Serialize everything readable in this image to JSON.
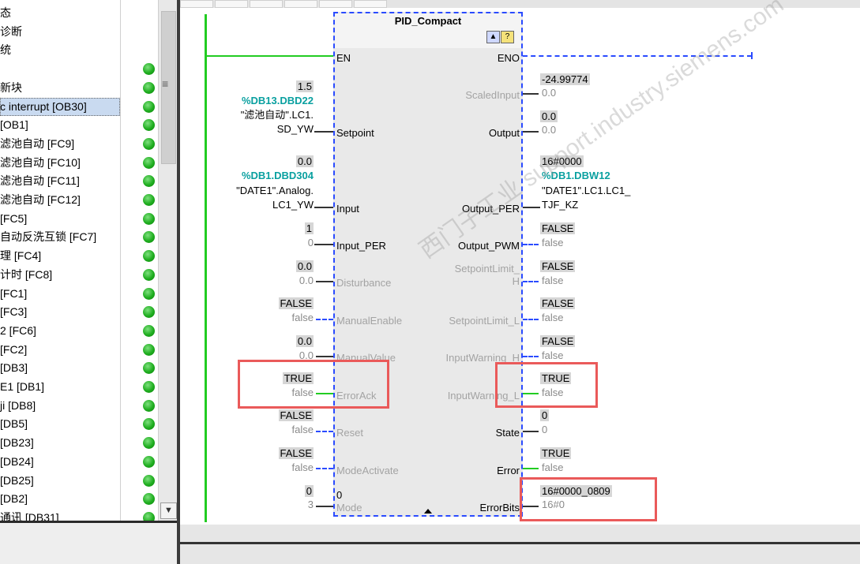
{
  "tree": {
    "items": [
      {
        "label": "态",
        "selected": false
      },
      {
        "label": "诊断",
        "selected": false
      },
      {
        "label": "统",
        "selected": false
      },
      {
        "label": "",
        "selected": false
      },
      {
        "label": "新块",
        "selected": false
      },
      {
        "label": "c interrupt [OB30]",
        "selected": true
      },
      {
        "label": " [OB1]",
        "selected": false
      },
      {
        "label": "滤池自动 [FC9]",
        "selected": false
      },
      {
        "label": "滤池自动 [FC10]",
        "selected": false
      },
      {
        "label": "滤池自动 [FC11]",
        "selected": false
      },
      {
        "label": "滤池自动 [FC12]",
        "selected": false
      },
      {
        "label": " [FC5]",
        "selected": false
      },
      {
        "label": "自动反洗互锁 [FC7]",
        "selected": false
      },
      {
        "label": "理 [FC4]",
        "selected": false
      },
      {
        "label": "计时 [FC8]",
        "selected": false
      },
      {
        "label": " [FC1]",
        "selected": false
      },
      {
        "label": " [FC3]",
        "selected": false
      },
      {
        "label": "2 [FC6]",
        "selected": false
      },
      {
        "label": " [FC2]",
        "selected": false
      },
      {
        "label": " [DB3]",
        "selected": false
      },
      {
        "label": "E1 [DB1]",
        "selected": false
      },
      {
        "label": "ji [DB8]",
        "selected": false
      },
      {
        "label": " [DB5]",
        "selected": false
      },
      {
        "label": " [DB23]",
        "selected": false
      },
      {
        "label": " [DB24]",
        "selected": false
      },
      {
        "label": " [DB25]",
        "selected": false
      },
      {
        "label": " [DB2]",
        "selected": false
      },
      {
        "label": "通讯 [DB31]",
        "selected": false
      }
    ],
    "scroll_glyph": "≡",
    "scroll_down": "▼"
  },
  "block": {
    "title": "PID_Compact",
    "icon1": "▲",
    "icon2": "?",
    "inputs": {
      "en": "EN",
      "setpoint": "Setpoint",
      "input": "Input",
      "input_per": "Input_PER",
      "disturbance": "Disturbance",
      "manual_enable": "ManualEnable",
      "manual_value": "ManualValue",
      "error_ack": "ErrorAck",
      "reset": "Reset",
      "mode_activate": "ModeActivate",
      "mode": "Mode",
      "mode_inner": "0"
    },
    "outputs": {
      "eno": "ENO",
      "scaled_input": "ScaledInput",
      "output": "Output",
      "output_per": "Output_PER",
      "output_pwm": "Output_PWM",
      "sp_limit_h1": "SetpointLimit_",
      "sp_limit_h2": "H",
      "sp_limit_l": "SetpointLimit_L",
      "input_warning_h": "InputWarning_H",
      "input_warning_l": "InputWarning_L",
      "state": "State",
      "error": "Error",
      "error_bits": "ErrorBits"
    }
  },
  "left_params": {
    "setpoint_val": "1.5",
    "setpoint_tag": "%DB13.DBD22",
    "setpoint_name1": "\"滤池自动\".LC1.",
    "setpoint_name2": "SD_YW",
    "input_val": "0.0",
    "input_tag": "%DB1.DBD304",
    "input_name1": "\"DATE1\".Analog.",
    "input_name2": "LC1_YW",
    "input_per_val": "1",
    "input_per_cur": "0",
    "disturbance_val": "0.0",
    "disturbance_cur": "0.0",
    "manual_enable_val": "FALSE",
    "manual_enable_cur": "false",
    "manual_value_val": "0.0",
    "manual_value_cur": "0.0",
    "error_ack_val": "TRUE",
    "error_ack_cur": "false",
    "reset_val": "FALSE",
    "reset_cur": "false",
    "mode_activate_val": "FALSE",
    "mode_activate_cur": "false",
    "mode_val": "0",
    "mode_cur": "3"
  },
  "right_params": {
    "scaled_input_val": "-24.99774",
    "scaled_input_cur": "0.0",
    "output_val": "0.0",
    "output_cur": "0.0",
    "output_per_val": "16#0000",
    "output_per_tag": "%DB1.DBW12",
    "output_per_name1": "\"DATE1\".LC1.LC1_",
    "output_per_name2": "TJF_KZ",
    "output_pwm_val": "FALSE",
    "output_pwm_cur": "false",
    "sp_limit_h_val": "FALSE",
    "sp_limit_h_cur": "false",
    "sp_limit_l_val": "FALSE",
    "sp_limit_l_cur": "false",
    "input_warning_h_val": "FALSE",
    "input_warning_h_cur": "false",
    "input_warning_l_val": "TRUE",
    "input_warning_l_cur": "false",
    "state_val": "0",
    "state_cur": "0",
    "error_val": "TRUE",
    "error_cur": "false",
    "error_bits_val": "16#0000_0809",
    "error_bits_cur": "16#0"
  },
  "watermark": "西门子工业 support.industry.siemens.com",
  "colors": {
    "rail": "#22cc22",
    "block_border": "#2a4bff",
    "tag": "#0aa0a0",
    "highlight": "#ea5a5a",
    "selection": "#c9daf0"
  }
}
